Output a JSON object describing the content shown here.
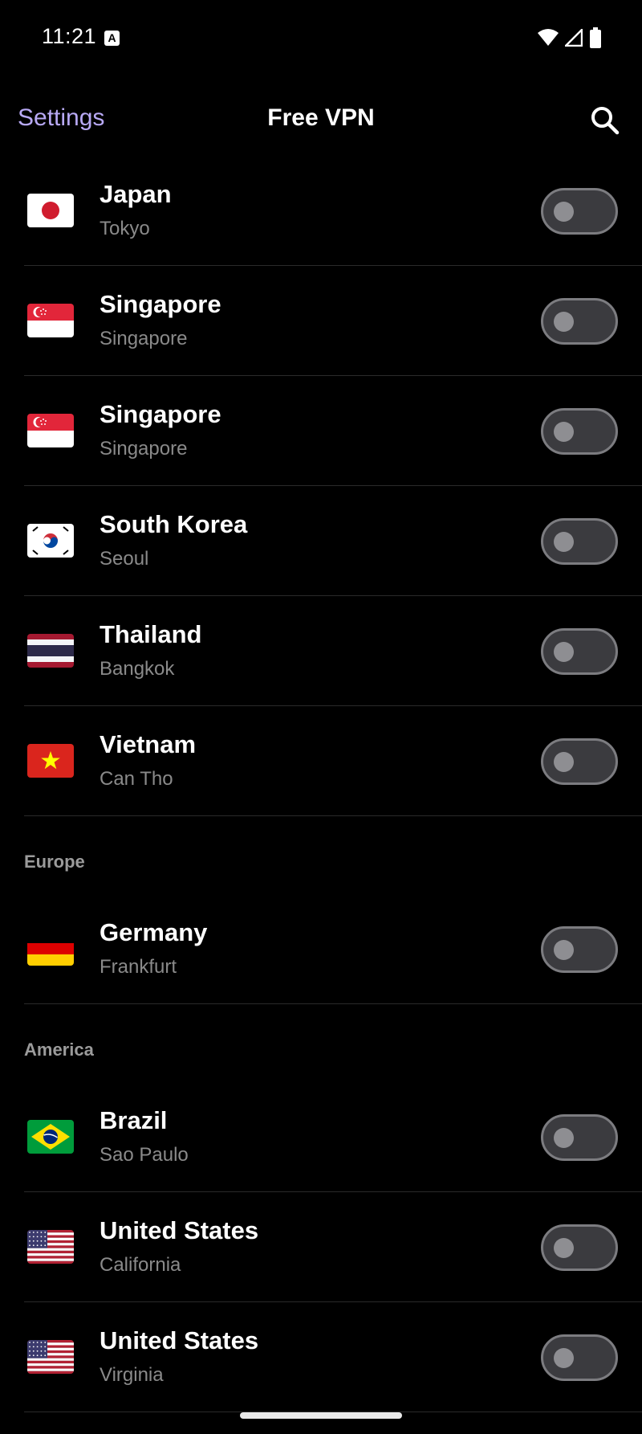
{
  "status_bar": {
    "time": "11:21",
    "notification_icon": "A",
    "icons": [
      "wifi-icon",
      "signal-icon",
      "battery-icon"
    ]
  },
  "app_bar": {
    "settings_label": "Settings",
    "title": "Free VPN",
    "search_icon": "search-icon"
  },
  "colors": {
    "accent": "#b8a9f5",
    "background": "#000000",
    "toggle_off_track": "#3b3b3f",
    "toggle_off_border": "#7c7c80",
    "secondary_text": "#8a8a8a"
  },
  "sections": [
    {
      "header": "",
      "servers": [
        {
          "country": "Japan",
          "city": "Tokyo",
          "flag": "jp",
          "enabled": false
        },
        {
          "country": "Singapore",
          "city": "Singapore",
          "flag": "sg",
          "enabled": false
        },
        {
          "country": "Singapore",
          "city": "Singapore",
          "flag": "sg",
          "enabled": false
        },
        {
          "country": "South Korea",
          "city": "Seoul",
          "flag": "kr",
          "enabled": false
        },
        {
          "country": "Thailand",
          "city": "Bangkok",
          "flag": "th",
          "enabled": false
        },
        {
          "country": "Vietnam",
          "city": "Can Tho",
          "flag": "vn",
          "enabled": false
        }
      ]
    },
    {
      "header": "Europe",
      "servers": [
        {
          "country": "Germany",
          "city": "Frankfurt",
          "flag": "de",
          "enabled": false
        }
      ]
    },
    {
      "header": "America",
      "servers": [
        {
          "country": "Brazil",
          "city": "Sao Paulo",
          "flag": "br",
          "enabled": false
        },
        {
          "country": "United States",
          "city": "California",
          "flag": "us",
          "enabled": false
        },
        {
          "country": "United States",
          "city": "Virginia",
          "flag": "us",
          "enabled": false
        }
      ]
    }
  ]
}
